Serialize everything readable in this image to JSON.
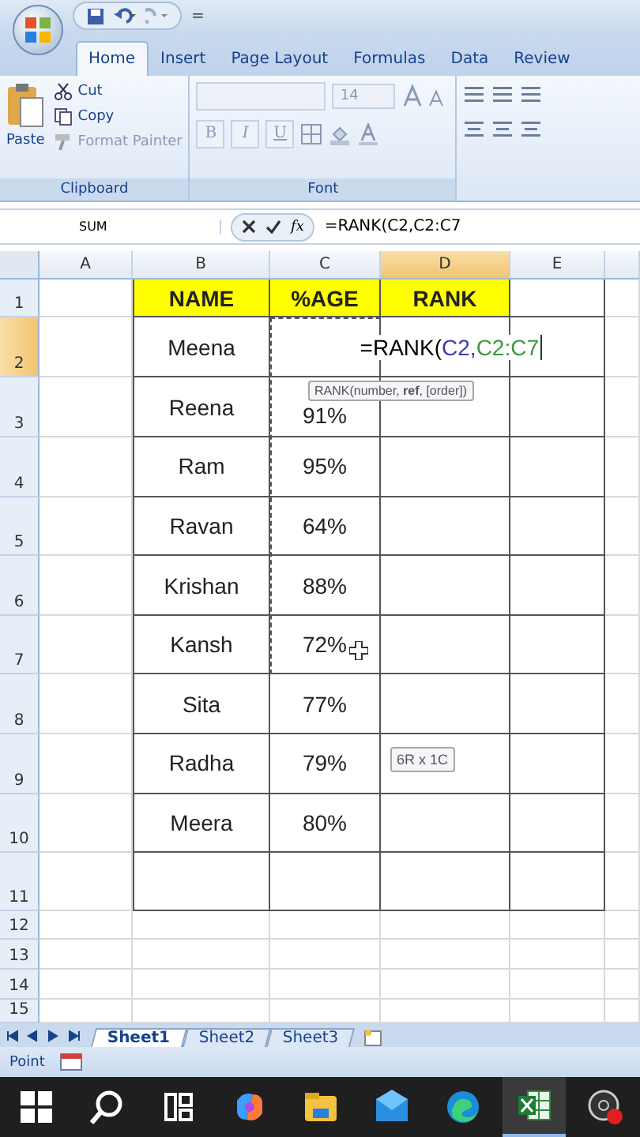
{
  "quick_access": {
    "title_mark": "="
  },
  "ribbon_tabs": [
    {
      "label": "Home",
      "selected": true
    },
    {
      "label": "Insert",
      "selected": false
    },
    {
      "label": "Page Layout",
      "selected": false
    },
    {
      "label": "Formulas",
      "selected": false
    },
    {
      "label": "Data",
      "selected": false
    },
    {
      "label": "Review",
      "selected": false
    }
  ],
  "clipboard": {
    "paste": "Paste",
    "cut": "Cut",
    "copy": "Copy",
    "format_painter": "Format Painter",
    "label": "Clipboard"
  },
  "font": {
    "size": "14",
    "bold": "B",
    "italic": "I",
    "underline": "U",
    "label": "Font"
  },
  "formula_bar": {
    "name_box": "SUM",
    "fx": "fx",
    "formula": "=RANK(C2,C2:C7"
  },
  "sheet": {
    "columns": [
      {
        "label": "A",
        "selected": false
      },
      {
        "label": "B",
        "selected": false
      },
      {
        "label": "C",
        "selected": false
      },
      {
        "label": "D",
        "selected": true
      },
      {
        "label": "E",
        "selected": false
      }
    ],
    "rows": [
      {
        "number": "1",
        "selected": false,
        "kind": "heading",
        "cells": [
          "",
          "NAME",
          "%AGE",
          "RANK",
          ""
        ]
      },
      {
        "number": "2",
        "selected": true,
        "kind": "data",
        "cells": [
          "",
          "Meena",
          "",
          "",
          ""
        ]
      },
      {
        "number": "3",
        "selected": false,
        "kind": "data",
        "cells": [
          "",
          "Reena",
          "91%",
          "",
          ""
        ]
      },
      {
        "number": "4",
        "selected": false,
        "kind": "data",
        "cells": [
          "",
          "Ram",
          "95%",
          "",
          ""
        ]
      },
      {
        "number": "5",
        "selected": false,
        "kind": "data",
        "cells": [
          "",
          "Ravan",
          "64%",
          "",
          ""
        ]
      },
      {
        "number": "6",
        "selected": false,
        "kind": "data",
        "cells": [
          "",
          "Krishan",
          "88%",
          "",
          ""
        ]
      },
      {
        "number": "7",
        "selected": false,
        "kind": "data",
        "cells": [
          "",
          "Kansh",
          "72%",
          "",
          ""
        ]
      },
      {
        "number": "8",
        "selected": false,
        "kind": "data",
        "cells": [
          "",
          "Sita",
          "77%",
          "",
          ""
        ]
      },
      {
        "number": "9",
        "selected": false,
        "kind": "data",
        "cells": [
          "",
          "Radha",
          "79%",
          "",
          ""
        ]
      },
      {
        "number": "10",
        "selected": false,
        "kind": "data",
        "cells": [
          "",
          "Meera",
          "80%",
          "",
          ""
        ]
      },
      {
        "number": "11",
        "selected": false,
        "kind": "data",
        "cells": [
          "",
          "",
          "",
          "",
          ""
        ]
      },
      {
        "number": "12",
        "selected": false,
        "kind": "blank",
        "cells": [
          "",
          "",
          "",
          "",
          ""
        ]
      },
      {
        "number": "13",
        "selected": false,
        "kind": "blank",
        "cells": [
          "",
          "",
          "",
          "",
          ""
        ]
      },
      {
        "number": "14",
        "selected": false,
        "kind": "blank",
        "cells": [
          "",
          "",
          "",
          "",
          ""
        ]
      },
      {
        "number": "15",
        "selected": false,
        "kind": "blank",
        "cells": [
          "",
          "",
          "",
          "",
          ""
        ]
      }
    ],
    "cell_editor": [
      {
        "text": "=RANK(",
        "color": "#000000"
      },
      {
        "text": "C2,",
        "color": "#3b3ba8"
      },
      {
        "text": "C2:C7",
        "color": "#3a9a3a"
      }
    ],
    "function_tooltip": "RANK(number, **ref**, [order])",
    "range_tooltip": "6R x 1C"
  },
  "sheet_tabs": [
    {
      "label": "Sheet1",
      "selected": true
    },
    {
      "label": "Sheet2",
      "selected": false
    },
    {
      "label": "Sheet3",
      "selected": false
    }
  ],
  "status_bar": {
    "mode": "Point"
  },
  "taskbar": [
    {
      "kind": "windows",
      "selected": false
    },
    {
      "kind": "search",
      "selected": false
    },
    {
      "kind": "taskview",
      "selected": false
    },
    {
      "kind": "copilot",
      "selected": false
    },
    {
      "kind": "folder",
      "selected": false
    },
    {
      "kind": "mail",
      "selected": false
    },
    {
      "kind": "edge",
      "selected": false
    },
    {
      "kind": "excel",
      "selected": true
    },
    {
      "kind": "recorder",
      "selected": false
    }
  ]
}
